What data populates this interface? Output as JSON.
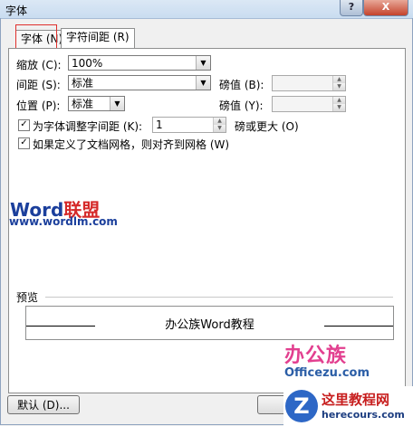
{
  "window": {
    "title": "字体",
    "help_label": "?",
    "close_label": "X"
  },
  "tabs": [
    {
      "label": "字体 (N)"
    },
    {
      "label": "字符间距 (R)"
    }
  ],
  "scale": {
    "label": "缩放 (C):",
    "value": "100%"
  },
  "spacing": {
    "label": "间距 (S):",
    "value": "标准",
    "by_label": "磅值 (B):",
    "by_value": ""
  },
  "position": {
    "label": "位置 (P):",
    "value": "标准",
    "by_label": "磅值 (Y):",
    "by_value": ""
  },
  "kerning": {
    "label": "为字体调整字间距 (K):",
    "checked": true,
    "value": "1",
    "suffix": "磅或更大 (O)"
  },
  "grid_snap": {
    "label": "如果定义了文档网格，则对齐到网格 (W)",
    "checked": true
  },
  "watermark": {
    "brand_word": "Word",
    "brand_cn": "联盟",
    "url": "www.wordlm.com"
  },
  "preview": {
    "label": "预览",
    "sample_text": "办公族Word教程"
  },
  "buttons": {
    "default_label": "默认 (D)..."
  },
  "logo": {
    "cn": "办公族",
    "domain": "Officezu.com"
  },
  "logo2": {
    "z": "Z",
    "cn": "这里教程网",
    "domain": "herecours.com"
  }
}
